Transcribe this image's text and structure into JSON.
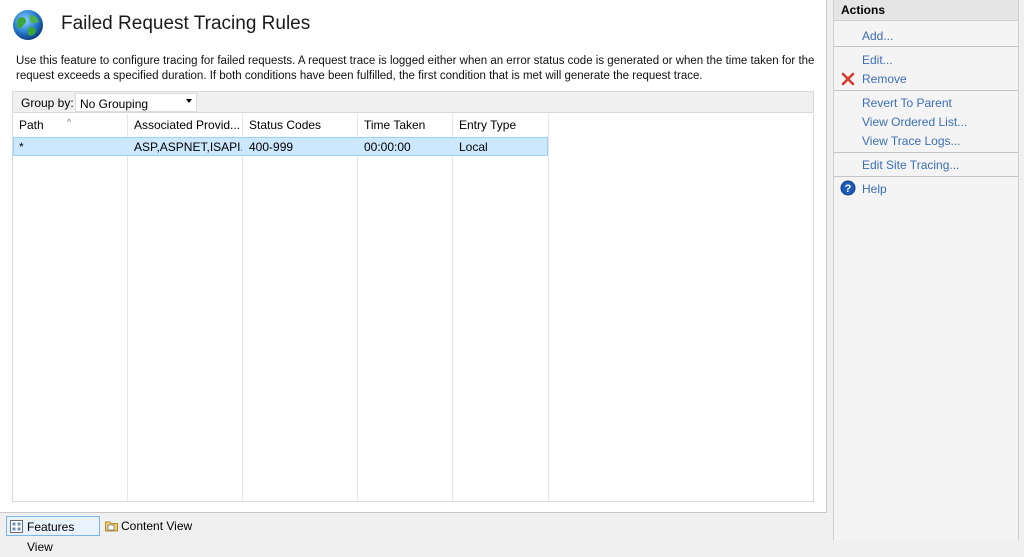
{
  "header": {
    "title": "Failed Request Tracing Rules",
    "description": "Use this feature to configure tracing for failed requests. A request trace is logged either when an error status code is generated or when the time taken for the request exceeds a specified duration. If both conditions have been fulfilled, the first condition that is met will generate the request trace.",
    "icon": "globe-icon"
  },
  "group_by": {
    "label": "Group by:",
    "value": "No Grouping"
  },
  "table": {
    "columns": [
      "Path",
      "Associated Provid...",
      "Status Codes",
      "Time Taken",
      "Entry Type"
    ],
    "rows": [
      {
        "path": "*",
        "providers": "ASP,ASPNET,ISAPI...",
        "status_codes": "400-999",
        "time_taken": "00:00:00",
        "entry_type": "Local"
      }
    ]
  },
  "actions": {
    "header": "Actions",
    "add": "Add...",
    "edit": "Edit...",
    "remove": "Remove",
    "revert": "Revert To Parent",
    "view_ordered": "View Ordered List...",
    "view_logs": "View Trace Logs...",
    "edit_site_tracing": "Edit Site Tracing...",
    "help": "Help"
  },
  "bottom_tabs": {
    "features_view": "Features View",
    "content_view": "Content View"
  },
  "colors": {
    "link": "#3c6eb4",
    "selection": "#cce8ff",
    "remove_icon": "#d83b2b",
    "help_icon": "#1e5bb8"
  }
}
